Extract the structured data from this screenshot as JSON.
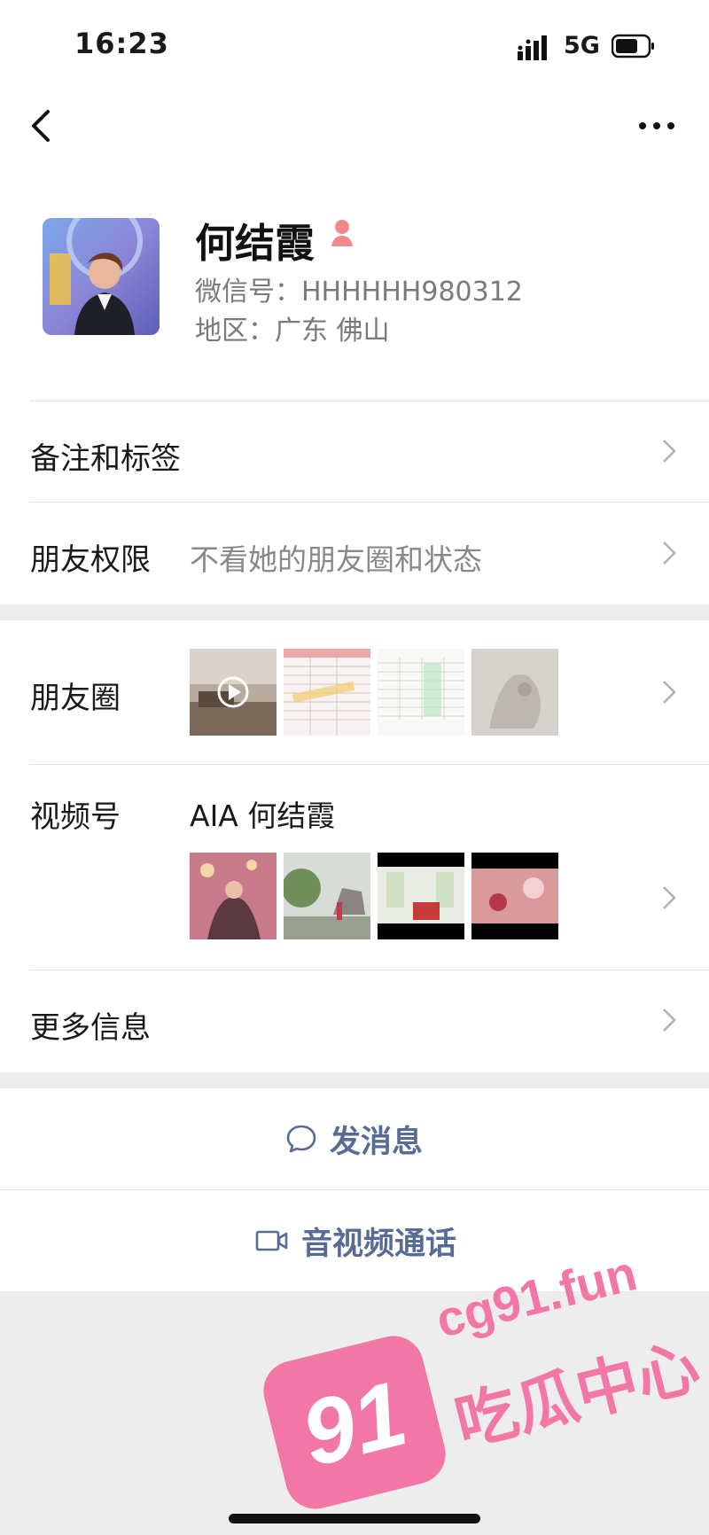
{
  "status_bar": {
    "time": "16:23",
    "network": "5G"
  },
  "profile": {
    "name": "何结霞",
    "wechat_id": "微信号：HHHHHH980312",
    "region": "地区：广东 佛山"
  },
  "rows": {
    "remarks": {
      "label": "备注和标签"
    },
    "permissions": {
      "label": "朋友权限",
      "value": "不看她的朋友圈和状态"
    },
    "moments": {
      "label": "朋友圈"
    },
    "channels": {
      "label": "视频号",
      "value": "AIA 何结霞"
    },
    "more_info": {
      "label": "更多信息"
    }
  },
  "actions": {
    "message": "发消息",
    "call": "音视频通话"
  },
  "watermark": {
    "badge": "91",
    "url": "cg91.fun",
    "text": "吃瓜中心"
  },
  "colors": {
    "link": "#576b95",
    "watermark": "#f277a6",
    "background": "#ededed"
  },
  "icons": [
    "back-chevron-icon",
    "more-dots-icon",
    "female-icon",
    "chevron-right-icon",
    "chat-bubble-icon",
    "video-camera-icon",
    "signal-icon",
    "battery-icon",
    "play-icon"
  ]
}
